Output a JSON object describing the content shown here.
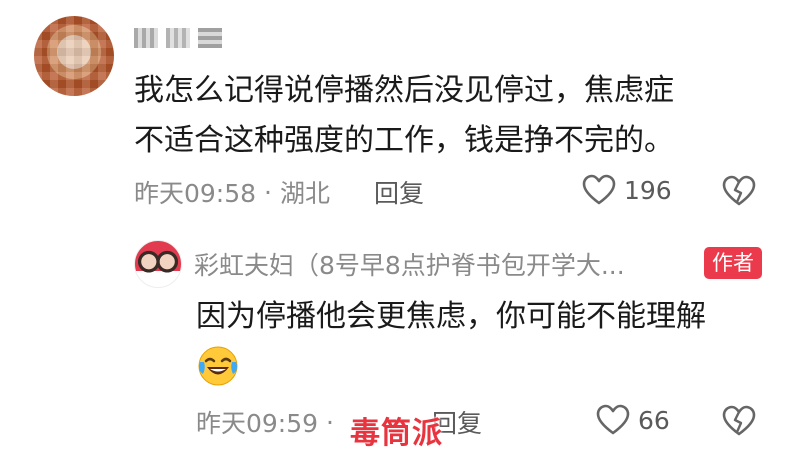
{
  "comment": {
    "username": "",
    "text_line1": "我怎么记得说停播然后没见停过，焦虑症",
    "text_line2": "不适合这种强度的工作，钱是挣不完的。",
    "timestamp": "昨天09:58",
    "location_sep": "·",
    "location": "湖北",
    "reply_label": "回复",
    "likes": "196"
  },
  "reply": {
    "username": "彩虹夫妇（8号早8点护脊书包开学大...",
    "author_badge": "作者",
    "text": "因为停播他会更焦虑，你可能不能理解",
    "emoji": "laughing-crying-emoji",
    "timestamp": "昨天09:59",
    "location_sep": "·",
    "reply_label": "回复",
    "likes": "66"
  },
  "watermark": "毒筒派",
  "colors": {
    "accent_red": "#ec3a4d",
    "meta_gray": "#8a8a8a"
  }
}
